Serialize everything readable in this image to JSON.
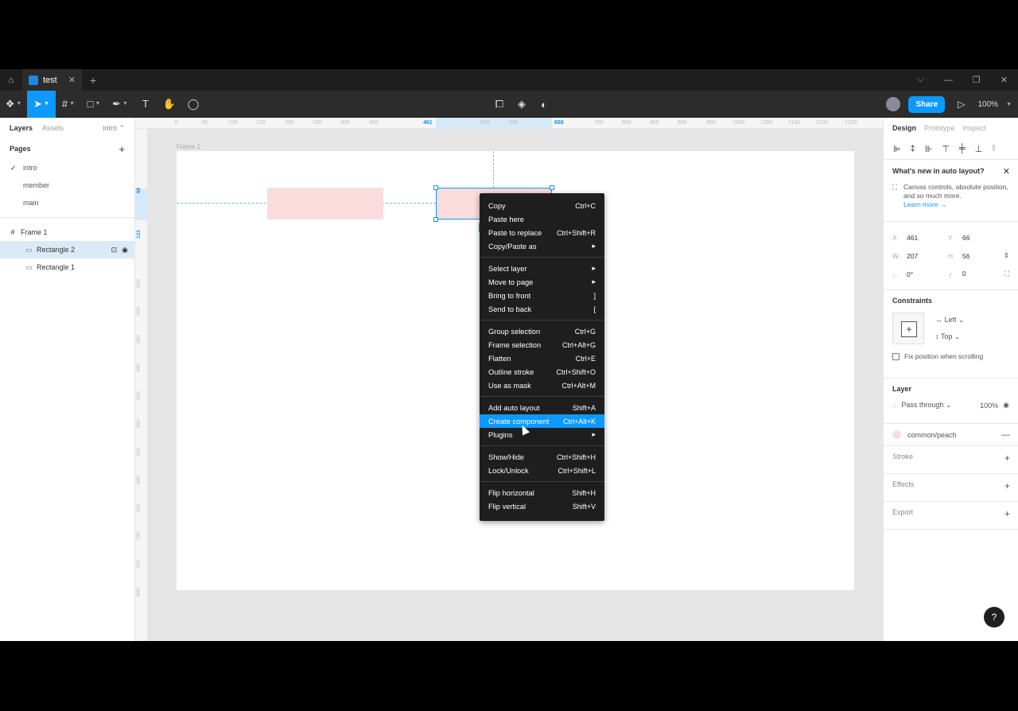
{
  "tabbar": {
    "file_tab": "test",
    "close": "✕",
    "new": "+",
    "win_min": "—",
    "win_restore": "❐",
    "win_close": "✕",
    "win_more": "⌵"
  },
  "toolbar": {
    "share": "Share",
    "zoom": "100%",
    "play": "▷"
  },
  "left": {
    "tab_layers": "Layers",
    "tab_assets": "Assets",
    "page_selector": "intro ⌃",
    "pages_title": "Pages",
    "add_page": "+",
    "pages": [
      {
        "label": "intro",
        "check": "✓"
      },
      {
        "label": "member",
        "check": ""
      },
      {
        "label": "main",
        "check": ""
      }
    ],
    "layers": [
      {
        "label": "Frame 1",
        "icon": "#"
      },
      {
        "label": "Rectangle 2",
        "icon": "▭"
      },
      {
        "label": "Rectangle 1",
        "icon": "▭"
      }
    ],
    "lock": "🔒",
    "eye": "👁"
  },
  "ruler": {
    "top": [
      "0",
      "50",
      "100",
      "150",
      "200",
      "250",
      "300",
      "350",
      "461",
      "550",
      "600",
      "668",
      "750",
      "800",
      "850",
      "900",
      "950",
      "1000",
      "1050",
      "1100",
      "1150",
      "1200"
    ],
    "left": [
      "66",
      "122",
      "250",
      "300",
      "350",
      "400",
      "450",
      "500",
      "550",
      "600",
      "650",
      "700",
      "750",
      "800"
    ]
  },
  "canvas": {
    "frame_label": "Frame 1"
  },
  "context_menu": {
    "groups": [
      [
        {
          "label": "Copy",
          "shortcut": "Ctrl+C"
        },
        {
          "label": "Paste here",
          "shortcut": ""
        },
        {
          "label": "Paste to replace",
          "shortcut": "Ctrl+Shift+R"
        },
        {
          "label": "Copy/Paste as",
          "shortcut": "▸"
        }
      ],
      [
        {
          "label": "Select layer",
          "shortcut": "▸"
        },
        {
          "label": "Move to page",
          "shortcut": "▸"
        },
        {
          "label": "Bring to front",
          "shortcut": "]"
        },
        {
          "label": "Send to back",
          "shortcut": "["
        }
      ],
      [
        {
          "label": "Group selection",
          "shortcut": "Ctrl+G"
        },
        {
          "label": "Frame selection",
          "shortcut": "Ctrl+Alt+G"
        },
        {
          "label": "Flatten",
          "shortcut": "Ctrl+E"
        },
        {
          "label": "Outline stroke",
          "shortcut": "Ctrl+Shift+O"
        },
        {
          "label": "Use as mask",
          "shortcut": "Ctrl+Alt+M"
        }
      ],
      [
        {
          "label": "Add auto layout",
          "shortcut": "Shift+A"
        },
        {
          "label": "Create component",
          "shortcut": "Ctrl+Alt+K"
        },
        {
          "label": "Plugins",
          "shortcut": "▸"
        }
      ],
      [
        {
          "label": "Show/Hide",
          "shortcut": "Ctrl+Shift+H"
        },
        {
          "label": "Lock/Unlock",
          "shortcut": "Ctrl+Shift+L"
        }
      ],
      [
        {
          "label": "Flip horizontal",
          "shortcut": "Shift+H"
        },
        {
          "label": "Flip vertical",
          "shortcut": "Shift+V"
        }
      ]
    ]
  },
  "right": {
    "tab_design": "Design",
    "tab_prototype": "Prototype",
    "tab_inspect": "Inspect",
    "whats_new_title": "What's new in auto layout?",
    "whats_new_body": "Canvas controls, absolute position, and so much more.",
    "learn_more": "Learn more →",
    "x_label": "X",
    "x": "461",
    "y_label": "Y",
    "y": "66",
    "w_label": "W",
    "w": "207",
    "h_label": "H",
    "h": "56",
    "rot": "0°",
    "radius": "0",
    "constraints_title": "Constraints",
    "constraint_h": "Left ⌄",
    "constraint_v": "Top ⌄",
    "fix_position": "Fix position when scrolling",
    "layer_title": "Layer",
    "blend": "Pass through ⌄",
    "opacity": "100%",
    "fill_name": "common/peach",
    "stroke": "Stroke",
    "effects": "Effects",
    "export": "Export"
  },
  "colors": {
    "accent": "#0d99ff",
    "fill": "#fbdcdc"
  },
  "help": "?"
}
